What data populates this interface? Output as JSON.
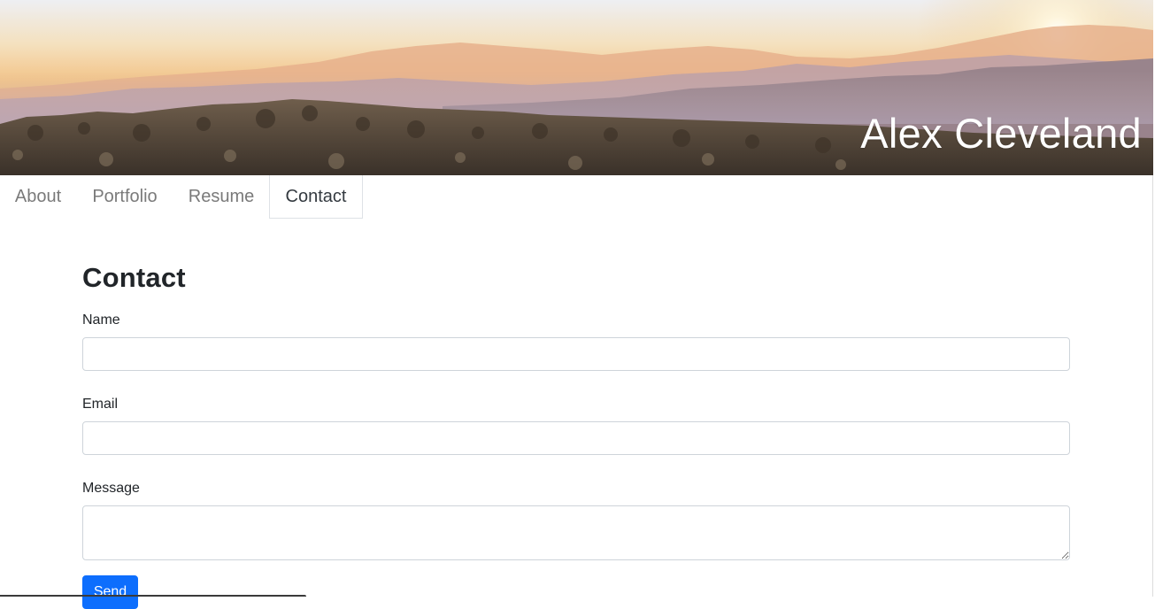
{
  "header": {
    "site_title": "Alex Cleveland"
  },
  "nav": {
    "items": [
      {
        "label": "About"
      },
      {
        "label": "Portfolio"
      },
      {
        "label": "Resume"
      },
      {
        "label": "Contact"
      }
    ],
    "active": "Contact"
  },
  "contact": {
    "heading": "Contact",
    "name_label": "Name",
    "name_value": "",
    "email_label": "Email",
    "email_value": "",
    "message_label": "Message",
    "message_value": "",
    "send_label": "Send"
  },
  "colors": {
    "primary_button": "#0d6efd",
    "active_tab_text": "#343a40",
    "inactive_tab_text": "#7a7a7a",
    "input_border": "#ced4da"
  }
}
